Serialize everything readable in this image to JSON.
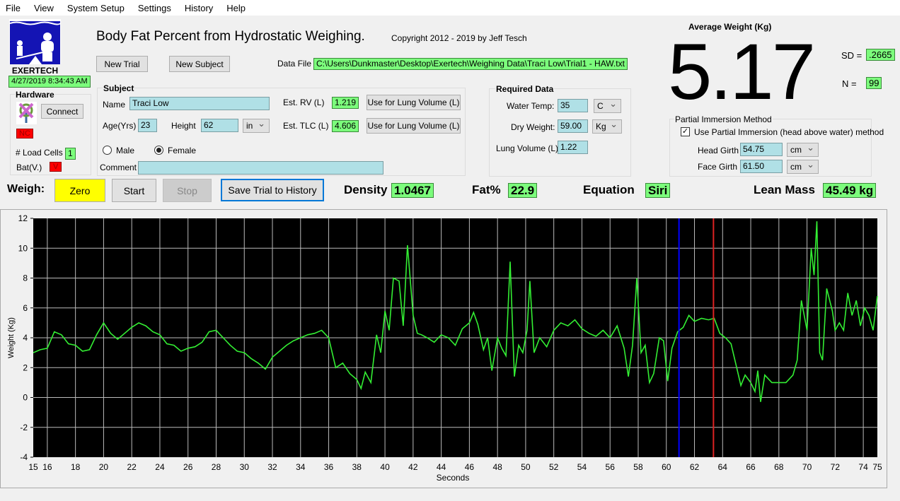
{
  "menu": [
    "File",
    "View",
    "System Setup",
    "Settings",
    "History",
    "Help"
  ],
  "header": {
    "title": "Body Fat Percent from Hydrostatic Weighing.",
    "copyright": "Copyright 2012 - 2019 by Jeff Tesch",
    "logo_text": "EXERTECH",
    "datetime": "4/27/2019 8:34:43 AM",
    "new_trial": "New Trial",
    "new_subject": "New Subject",
    "data_file_label": "Data File",
    "data_file": "C:\\Users\\Dunkmaster\\Desktop\\Exertech\\Weighing Data\\Traci Low\\Trial1 - HAW.txt"
  },
  "hardware": {
    "title": "Hardware",
    "connect": "Connect",
    "status": "NC",
    "load_cells_label": "# Load Cells",
    "load_cells": "1",
    "bat_label": "Bat(V.)",
    "bat": "V",
    "icon": "antenna-disconnected-icon"
  },
  "subject": {
    "title": "Subject",
    "name_label": "Name",
    "name": "Traci Low",
    "age_label": "Age(Yrs)",
    "age": "23",
    "height_label": "Height",
    "height": "62",
    "height_unit": "in",
    "male": "Male",
    "female": "Female",
    "sex_selected": "Female",
    "comment_label": "Comment",
    "comment": "",
    "rv_label": "Est. RV (L)",
    "rv": "1.219",
    "tlc_label": "Est. TLC (L)",
    "tlc": "4.606",
    "use_lung": "Use for Lung Volume (L)"
  },
  "required": {
    "title": "Required Data",
    "water_temp_label": "Water Temp:",
    "water_temp": "35",
    "temp_unit": "C",
    "dry_weight_label": "Dry Weight:",
    "dry_weight": "59.00",
    "weight_unit": "Kg",
    "lung_label": "Lung Volume (L):",
    "lung": "1.22"
  },
  "average": {
    "title": "Average Weight (Kg)",
    "value": "5.17",
    "sd_label": "SD =",
    "sd": ".2665",
    "n_label": "N =",
    "n": "99"
  },
  "partial": {
    "title": "Partial Immersion Method",
    "checkbox": "Use Partial Immersion (head above water) method",
    "checked": true,
    "head_label": "Head Girth",
    "head": "54.75",
    "head_unit": "cm",
    "face_label": "Face Girth",
    "face": "61.50",
    "face_unit": "cm"
  },
  "weigh": {
    "label": "Weigh:",
    "zero": "Zero",
    "start": "Start",
    "stop": "Stop",
    "save": "Save Trial to History",
    "density_label": "Density",
    "density": "1.0467",
    "fat_label": "Fat%",
    "fat": "22.9",
    "equation_label": "Equation",
    "equation": "Siri",
    "lean_label": "Lean Mass",
    "lean": "45.49 kg"
  },
  "colors": {
    "input": "#b0e0e6",
    "readout": "#7cfc7c",
    "alert": "#ff0000",
    "zero": "#ffff00",
    "trace": "#33ee33",
    "plot_bg": "#000000"
  },
  "chart_data": {
    "type": "line",
    "xlabel": "Seconds",
    "ylabel": "Weight (Kg)",
    "xlim": [
      15,
      75
    ],
    "ylim": [
      -4,
      12
    ],
    "grid": true,
    "xticks": [
      15,
      16,
      18,
      20,
      22,
      24,
      26,
      28,
      30,
      32,
      34,
      36,
      38,
      40,
      42,
      44,
      46,
      48,
      50,
      52,
      54,
      56,
      58,
      60,
      62,
      64,
      66,
      68,
      70,
      72,
      74,
      75
    ],
    "yticks": [
      -4,
      -2,
      0,
      2,
      4,
      6,
      8,
      10,
      12
    ],
    "markers": [
      {
        "x": 60.9,
        "color": "#0000ff"
      },
      {
        "x": 63.35,
        "color": "#dd2222"
      }
    ],
    "x": [
      15,
      15.5,
      16,
      16.5,
      17,
      17.5,
      18,
      18.5,
      19,
      19.5,
      20,
      20.5,
      21,
      21.5,
      22,
      22.5,
      23,
      23.5,
      24,
      24.5,
      25,
      25.5,
      26,
      26.5,
      27,
      27.5,
      28,
      28.5,
      29,
      29.5,
      30,
      30.5,
      31,
      31.5,
      32,
      32.5,
      33,
      33.5,
      34,
      34.5,
      35,
      35.5,
      36,
      36.3,
      36.5,
      37,
      37.5,
      38,
      38.3,
      38.6,
      39,
      39.4,
      39.7,
      40,
      40.3,
      40.6,
      41,
      41.3,
      41.6,
      42,
      42.3,
      42.6,
      43,
      43.5,
      44,
      44.5,
      45,
      45.5,
      46,
      46.3,
      46.6,
      47,
      47.3,
      47.6,
      48,
      48.3,
      48.6,
      48.9,
      49.2,
      49.5,
      49.8,
      50.1,
      50.3,
      50.6,
      51,
      51.5,
      52,
      52.5,
      53,
      53.5,
      54,
      54.5,
      55,
      55.5,
      56,
      56.5,
      57,
      57.3,
      57.6,
      57.9,
      58.2,
      58.5,
      58.8,
      59.1,
      59.5,
      59.8,
      60.1,
      60.4,
      60.8,
      61.2,
      61.6,
      62,
      62.5,
      63,
      63.4,
      63.8,
      64.2,
      64.6,
      65,
      65.3,
      65.6,
      66,
      66.3,
      66.5,
      66.7,
      67,
      67.5,
      68,
      68.5,
      69,
      69.3,
      69.6,
      70,
      70.3,
      70.5,
      70.7,
      70.9,
      71.1,
      71.4,
      71.8,
      72,
      72.3,
      72.6,
      72.9,
      73.2,
      73.5,
      73.8,
      74.1,
      74.4,
      74.7,
      75
    ],
    "y": [
      3.0,
      3.2,
      3.3,
      4.4,
      4.2,
      3.6,
      3.5,
      3.1,
      3.2,
      4.2,
      5.0,
      4.3,
      3.9,
      4.3,
      4.7,
      5.0,
      4.8,
      4.4,
      4.2,
      3.6,
      3.5,
      3.1,
      3.3,
      3.4,
      3.7,
      4.4,
      4.5,
      4.0,
      3.5,
      3.1,
      3.0,
      2.6,
      2.3,
      1.9,
      2.7,
      3.1,
      3.5,
      3.8,
      4.0,
      4.2,
      4.3,
      4.5,
      4.0,
      2.8,
      2.0,
      2.3,
      1.6,
      1.2,
      0.6,
      1.7,
      1.0,
      4.2,
      3.0,
      5.8,
      4.5,
      8.0,
      7.8,
      4.8,
      10.2,
      5.5,
      4.3,
      4.2,
      4.0,
      3.7,
      4.2,
      4.0,
      3.5,
      4.6,
      5.0,
      5.7,
      4.9,
      3.2,
      4.0,
      1.8,
      4.0,
      3.3,
      2.8,
      9.1,
      1.4,
      3.5,
      3.0,
      4.5,
      7.8,
      3.0,
      4.0,
      3.4,
      4.5,
      5.0,
      4.8,
      5.2,
      4.6,
      4.3,
      4.1,
      4.5,
      4.0,
      4.8,
      3.3,
      1.4,
      3.5,
      8.0,
      3.0,
      3.5,
      1.0,
      1.6,
      4.0,
      3.8,
      1.1,
      3.3,
      4.4,
      4.7,
      5.5,
      5.1,
      5.3,
      5.2,
      5.3,
      4.3,
      4.0,
      3.6,
      2.0,
      0.8,
      1.5,
      1.0,
      0.4,
      1.8,
      -0.3,
      1.5,
      1.0,
      1.0,
      1.0,
      1.5,
      2.5,
      6.5,
      4.5,
      10.0,
      8.2,
      11.8,
      3.0,
      2.5,
      7.3,
      5.8,
      4.5,
      5.0,
      4.5,
      7.0,
      5.5,
      6.5,
      4.8,
      6.0,
      5.5,
      4.5,
      6.8
    ]
  }
}
